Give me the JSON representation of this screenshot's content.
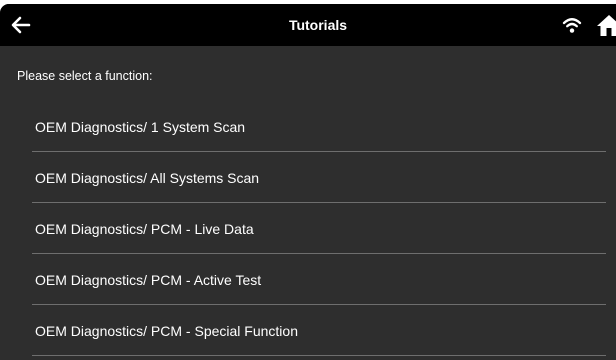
{
  "header": {
    "title": "Tutorials",
    "back_icon": "arrow-left-icon",
    "wifi_icon": "wifi-icon",
    "home_icon": "home-icon"
  },
  "prompt": "Please select a function:",
  "menu": {
    "items": [
      {
        "label": "OEM Diagnostics/ 1 System Scan"
      },
      {
        "label": "OEM Diagnostics/ All Systems Scan"
      },
      {
        "label": "OEM Diagnostics/ PCM - Live Data"
      },
      {
        "label": "OEM Diagnostics/ PCM - Active Test"
      },
      {
        "label": "OEM Diagnostics/ PCM - Special Function"
      }
    ]
  },
  "colors": {
    "header_bg": "#000000",
    "content_bg": "#2e2e2e",
    "text": "#ffffff",
    "divider": "#6e6e6e"
  }
}
